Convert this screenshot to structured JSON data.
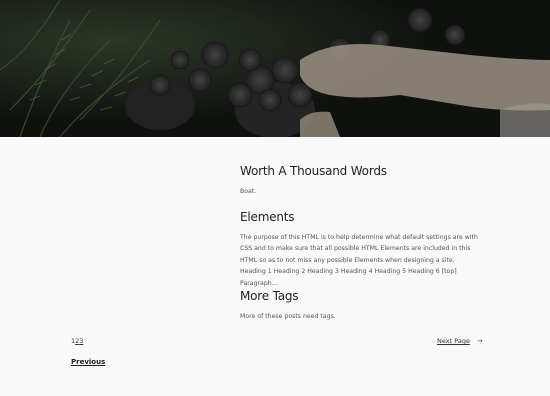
{
  "hero": {
    "image": "plant-pot-photo"
  },
  "posts": [
    {
      "title": "Worth A Thousand Words",
      "excerpt": "Boat."
    },
    {
      "title": "Elements",
      "excerpt": "The purpose of this HTML is to help determine what default settings are with CSS and to make sure that all possible HTML Elements are included in this HTML so as to not miss any possible Elements when designing a site. Heading 1 Heading 2 Heading 3 Heading 4 Heading 5 Heading 6 [top] Paragraph…"
    },
    {
      "title": "More Tags",
      "excerpt": "More of these posts need tags."
    }
  ],
  "pagination": {
    "pages": [
      "1",
      "2",
      "3"
    ],
    "next_label": "Next Page",
    "next_arrow": "→",
    "previous_label": "Previous"
  }
}
